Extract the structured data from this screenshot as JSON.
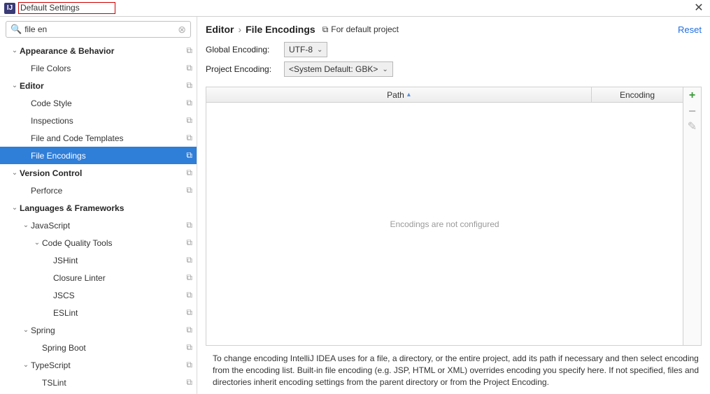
{
  "window": {
    "title": "Default Settings",
    "close_glyph": "✕",
    "app_glyph": "IJ"
  },
  "search": {
    "value": "file en",
    "search_glyph": "🔍",
    "clear_glyph": "⊗"
  },
  "tree": [
    {
      "label": "Appearance & Behavior",
      "cat": true,
      "expand": true,
      "indent": 1,
      "tail": "⧉"
    },
    {
      "label": "File Colors",
      "cat": false,
      "expand": false,
      "indent": 2,
      "tail": "⧉",
      "leaf": true
    },
    {
      "label": "Editor",
      "cat": true,
      "expand": true,
      "indent": 1,
      "tail": "⧉"
    },
    {
      "label": "Code Style",
      "cat": false,
      "expand": false,
      "indent": 2,
      "tail": "⧉",
      "leaf": true
    },
    {
      "label": "Inspections",
      "cat": false,
      "expand": false,
      "indent": 2,
      "tail": "⧉",
      "leaf": true
    },
    {
      "label": "File and Code Templates",
      "cat": false,
      "expand": false,
      "indent": 2,
      "tail": "⧉",
      "leaf": true
    },
    {
      "label": "File Encodings",
      "cat": false,
      "expand": false,
      "indent": 2,
      "tail": "⧉",
      "selected": true,
      "leaf": true
    },
    {
      "label": "Version Control",
      "cat": true,
      "expand": true,
      "indent": 1,
      "tail": "⧉"
    },
    {
      "label": "Perforce",
      "cat": false,
      "expand": false,
      "indent": 2,
      "tail": "⧉",
      "leaf": true
    },
    {
      "label": "Languages & Frameworks",
      "cat": true,
      "expand": true,
      "indent": 1,
      "tail": ""
    },
    {
      "label": "JavaScript",
      "cat": false,
      "expand": true,
      "indent": 2,
      "tail": "⧉"
    },
    {
      "label": "Code Quality Tools",
      "cat": false,
      "expand": true,
      "indent": 3,
      "tail": "⧉"
    },
    {
      "label": "JSHint",
      "cat": false,
      "expand": false,
      "indent": 4,
      "tail": "⧉",
      "leaf": true
    },
    {
      "label": "Closure Linter",
      "cat": false,
      "expand": false,
      "indent": 4,
      "tail": "⧉",
      "leaf": true
    },
    {
      "label": "JSCS",
      "cat": false,
      "expand": false,
      "indent": 4,
      "tail": "⧉",
      "leaf": true
    },
    {
      "label": "ESLint",
      "cat": false,
      "expand": false,
      "indent": 4,
      "tail": "⧉",
      "leaf": true
    },
    {
      "label": "Spring",
      "cat": false,
      "expand": true,
      "indent": 2,
      "tail": "⧉"
    },
    {
      "label": "Spring Boot",
      "cat": false,
      "expand": false,
      "indent": 3,
      "tail": "⧉",
      "leaf": true
    },
    {
      "label": "TypeScript",
      "cat": false,
      "expand": true,
      "indent": 2,
      "tail": "⧉"
    },
    {
      "label": "TSLint",
      "cat": false,
      "expand": false,
      "indent": 3,
      "tail": "⧉",
      "leaf": true
    }
  ],
  "header": {
    "crumb_parent": "Editor",
    "crumb_sep": "›",
    "crumb_leaf": "File Encodings",
    "scope_text": "For default project",
    "scope_glyph": "⧉",
    "reset": "Reset"
  },
  "fields": {
    "global_label": "Global Encoding:",
    "global_value": "UTF-8",
    "project_label": "Project Encoding:",
    "project_value": "<System Default: GBK>",
    "down_glyph": "⌄"
  },
  "table": {
    "col_path": "Path",
    "col_enc": "Encoding",
    "sort_glyph": "▴",
    "empty": "Encodings are not configured"
  },
  "tools": {
    "add": "+",
    "remove": "−",
    "edit": "✎"
  },
  "hint": "To change encoding IntelliJ IDEA uses for a file, a directory, or the entire project, add its path if necessary and then select encoding from the encoding list. Built-in file encoding (e.g. JSP, HTML or XML) overrides encoding you specify here. If not specified, files and directories inherit encoding settings from the parent directory or from the Project Encoding."
}
